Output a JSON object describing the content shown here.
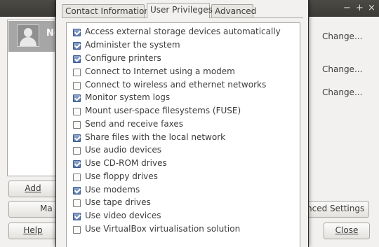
{
  "background_window": {
    "controls": {
      "minimize": "−",
      "maximize": "+",
      "close": "×"
    },
    "user_name": "Ne",
    "change_links": [
      "Change...",
      "Change...",
      "Change..."
    ],
    "add_button": "Add",
    "manage_button": "Ma",
    "help_button": "Help",
    "advanced_settings_button": "nced Settings",
    "close_button": "Close"
  },
  "dialog": {
    "tabs": [
      {
        "label": "Contact Information",
        "active": false
      },
      {
        "label": "User Privileges",
        "active": true
      },
      {
        "label": "Advanced",
        "active": false
      }
    ],
    "privileges": [
      {
        "label": "Access external storage devices automatically",
        "checked": true
      },
      {
        "label": "Administer the system",
        "checked": true
      },
      {
        "label": "Configure printers",
        "checked": true
      },
      {
        "label": "Connect to Internet using a modem",
        "checked": false
      },
      {
        "label": "Connect to wireless and ethernet networks",
        "checked": false
      },
      {
        "label": "Monitor system logs",
        "checked": true
      },
      {
        "label": "Mount user-space filesystems (FUSE)",
        "checked": false
      },
      {
        "label": "Send and receive faxes",
        "checked": false
      },
      {
        "label": "Share files with the local network",
        "checked": true
      },
      {
        "label": "Use audio devices",
        "checked": false
      },
      {
        "label": "Use CD-ROM drives",
        "checked": true
      },
      {
        "label": "Use floppy drives",
        "checked": false
      },
      {
        "label": "Use modems",
        "checked": true
      },
      {
        "label": "Use tape drives",
        "checked": false
      },
      {
        "label": "Use video devices",
        "checked": true
      },
      {
        "label": "Use VirtualBox virtualisation solution",
        "checked": false
      }
    ]
  }
}
